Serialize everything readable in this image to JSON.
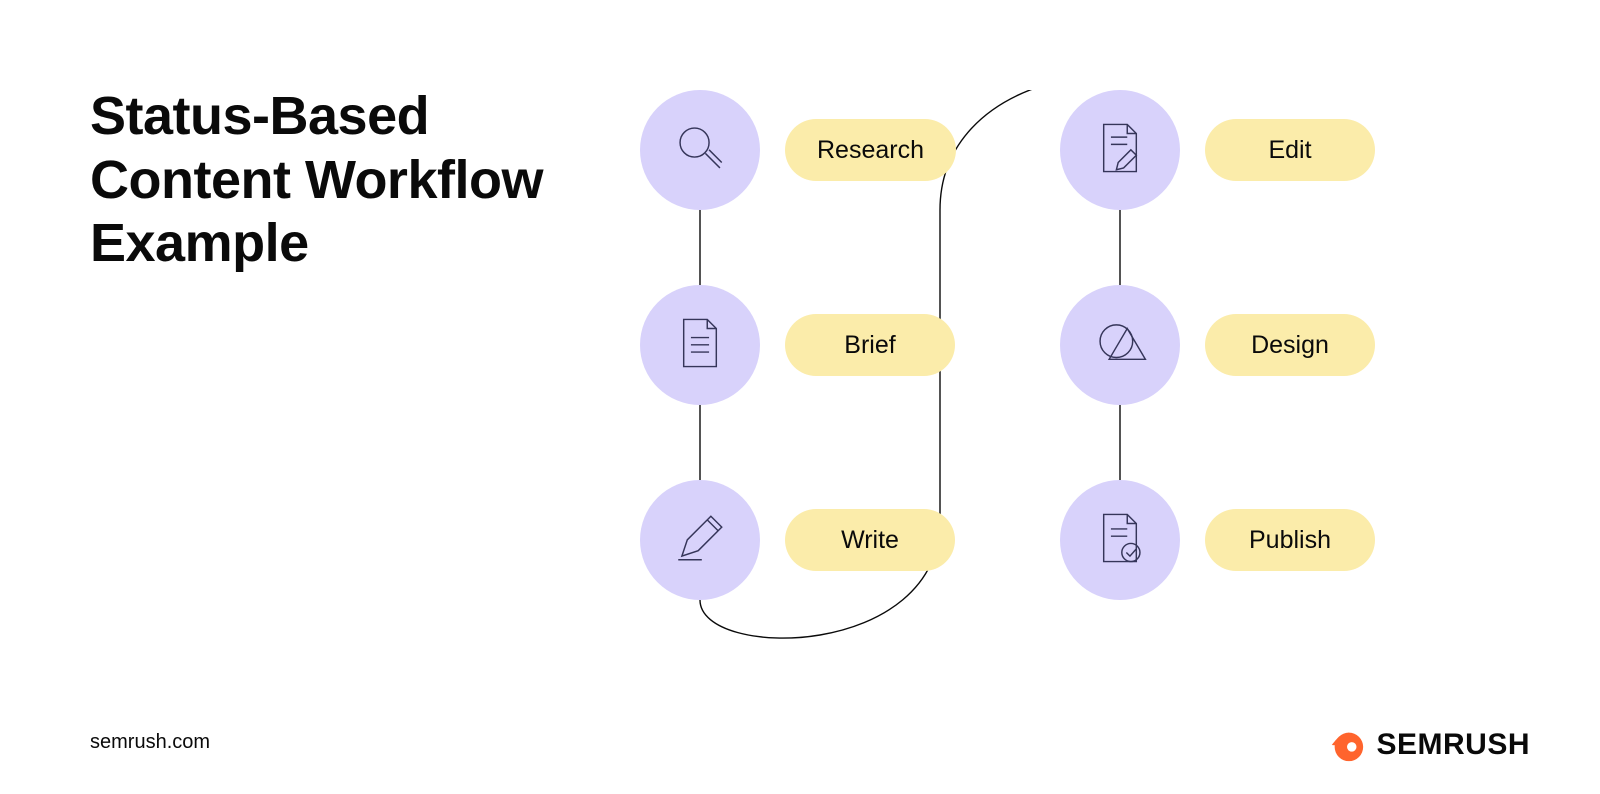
{
  "title": "Status-Based\nContent Workflow\nExample",
  "url": "semrush.com",
  "brand": "SEMRUSH",
  "steps": [
    {
      "label": "Research",
      "icon": "magnifier-icon"
    },
    {
      "label": "Brief",
      "icon": "document-icon"
    },
    {
      "label": "Write",
      "icon": "pencil-icon"
    },
    {
      "label": "Edit",
      "icon": "edit-doc-icon"
    },
    {
      "label": "Design",
      "icon": "shapes-icon"
    },
    {
      "label": "Publish",
      "icon": "check-doc-icon"
    }
  ],
  "colors": {
    "circle": "#d8d2fb",
    "pill": "#fbecaa",
    "accent": "#ff642d"
  }
}
